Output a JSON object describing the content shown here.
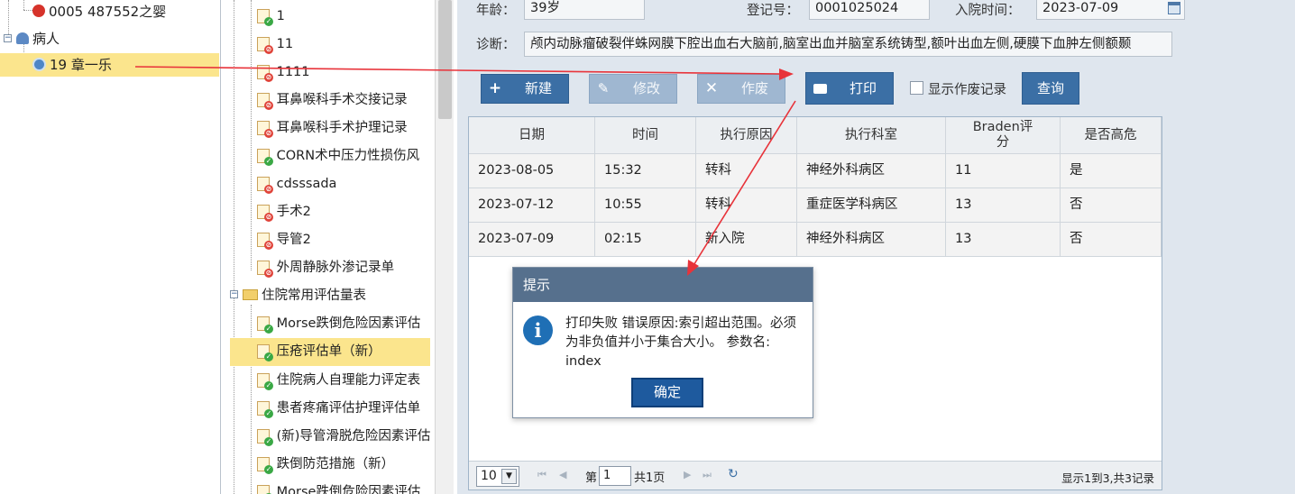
{
  "patient_tree": {
    "top_item": "0005 487552之婴",
    "group_label": "病人",
    "selected_patient": "19 章一乐"
  },
  "form_tree": {
    "items": [
      {
        "label": "1",
        "status": "ok"
      },
      {
        "label": "11",
        "status": "no"
      },
      {
        "label": "1111",
        "status": "no"
      },
      {
        "label": "耳鼻喉科手术交接记录",
        "status": "no"
      },
      {
        "label": "耳鼻喉科手术护理记录",
        "status": "no"
      },
      {
        "label": "CORN术中压力性损伤风",
        "status": "ok"
      },
      {
        "label": "cdsssada",
        "status": "no"
      },
      {
        "label": "手术2",
        "status": "no"
      },
      {
        "label": "导管2",
        "status": "no"
      },
      {
        "label": "外周静脉外渗记录单",
        "status": "no"
      }
    ],
    "folder_label": "住院常用评估量表",
    "folder_items": [
      {
        "label": "Morse跌倒危险因素评估",
        "status": "ok"
      },
      {
        "label": "压疮评估单（新）",
        "status": "ok"
      },
      {
        "label": "住院病人自理能力评定表",
        "status": "ok"
      },
      {
        "label": "患者疼痛评估护理评估单",
        "status": "ok"
      },
      {
        "label": "(新)导管滑脱危险因素评估",
        "status": "ok"
      },
      {
        "label": "跌倒防范措施（新）",
        "status": "ok"
      },
      {
        "label": "Morse跌倒危险因素评估",
        "status": "ok"
      }
    ]
  },
  "patient_info": {
    "age_label": "年龄：",
    "age_value": "39岁",
    "reg_label": "登记号：",
    "reg_value": "0001025024",
    "admit_label": "入院时间：",
    "admit_value": "2023-07-09",
    "diag_label": "诊断：",
    "diag_value": "颅内动脉瘤破裂伴蛛网膜下腔出血右大脑前,脑室出血并脑室系统铸型,额叶出血左侧,硬膜下血肿左侧额颞"
  },
  "toolbar": {
    "new_label": "新建",
    "edit_label": "修改",
    "void_label": "作废",
    "print_label": "打印",
    "show_void_label": "显示作废记录",
    "query_label": "查询"
  },
  "grid": {
    "columns": [
      "日期",
      "时间",
      "执行原因",
      "执行科室",
      "Braden评\n分",
      "是否高危"
    ],
    "rows": [
      [
        "2023-08-05",
        "15:32",
        "转科",
        "神经外科病区",
        "11",
        "是"
      ],
      [
        "2023-07-12",
        "10:55",
        "转科",
        "重症医学科病区",
        "13",
        "否"
      ],
      [
        "2023-07-09",
        "02:15",
        "新入院",
        "神经外科病区",
        "13",
        "否"
      ]
    ]
  },
  "pager": {
    "page_size": "10",
    "page_prefix": "第",
    "page_number": "1",
    "page_total": "共1页",
    "summary": "显示1到3,共3记录"
  },
  "dialog": {
    "title": "提示",
    "message": "打印失败 错误原因:索引超出范围。必须为非负值并小于集合大小。 参数名: index",
    "ok_label": "确定"
  },
  "colors": {
    "toolbar_button": "#3b6fa5",
    "dialog_header": "#56708d",
    "selection_highlight": "#fbe58d",
    "annotation_arrow": "#e8333a"
  }
}
